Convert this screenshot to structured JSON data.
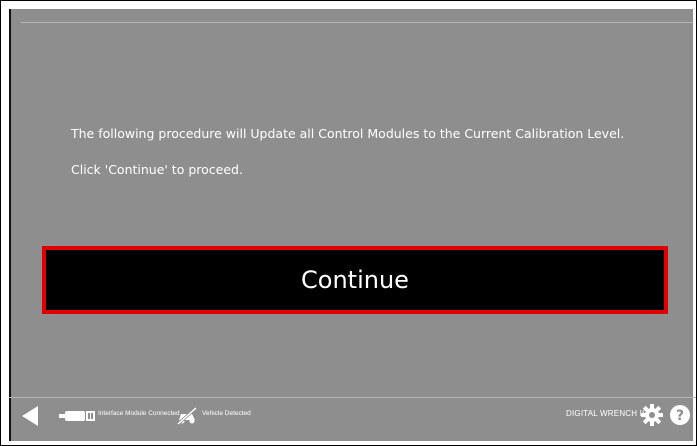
{
  "message": {
    "line1": "The following procedure will Update all Control Modules to the Current Calibration Level.",
    "line2": "Click 'Continue' to proceed."
  },
  "actions": {
    "continue_label": "Continue"
  },
  "footer": {
    "interface_status": "Interface Module Connected",
    "vehicle_status": "Vehicle Detected",
    "brand": "DIGITAL WRENCH II",
    "icons": [
      "back-arrow-icon",
      "interface-module-icon",
      "vehicle-disconnected-icon",
      "gear-icon",
      "help-icon"
    ]
  },
  "colors": {
    "panel": "#8e8e8e",
    "button_bg": "#000000",
    "button_border": "#e00000",
    "text": "#ffffff"
  }
}
